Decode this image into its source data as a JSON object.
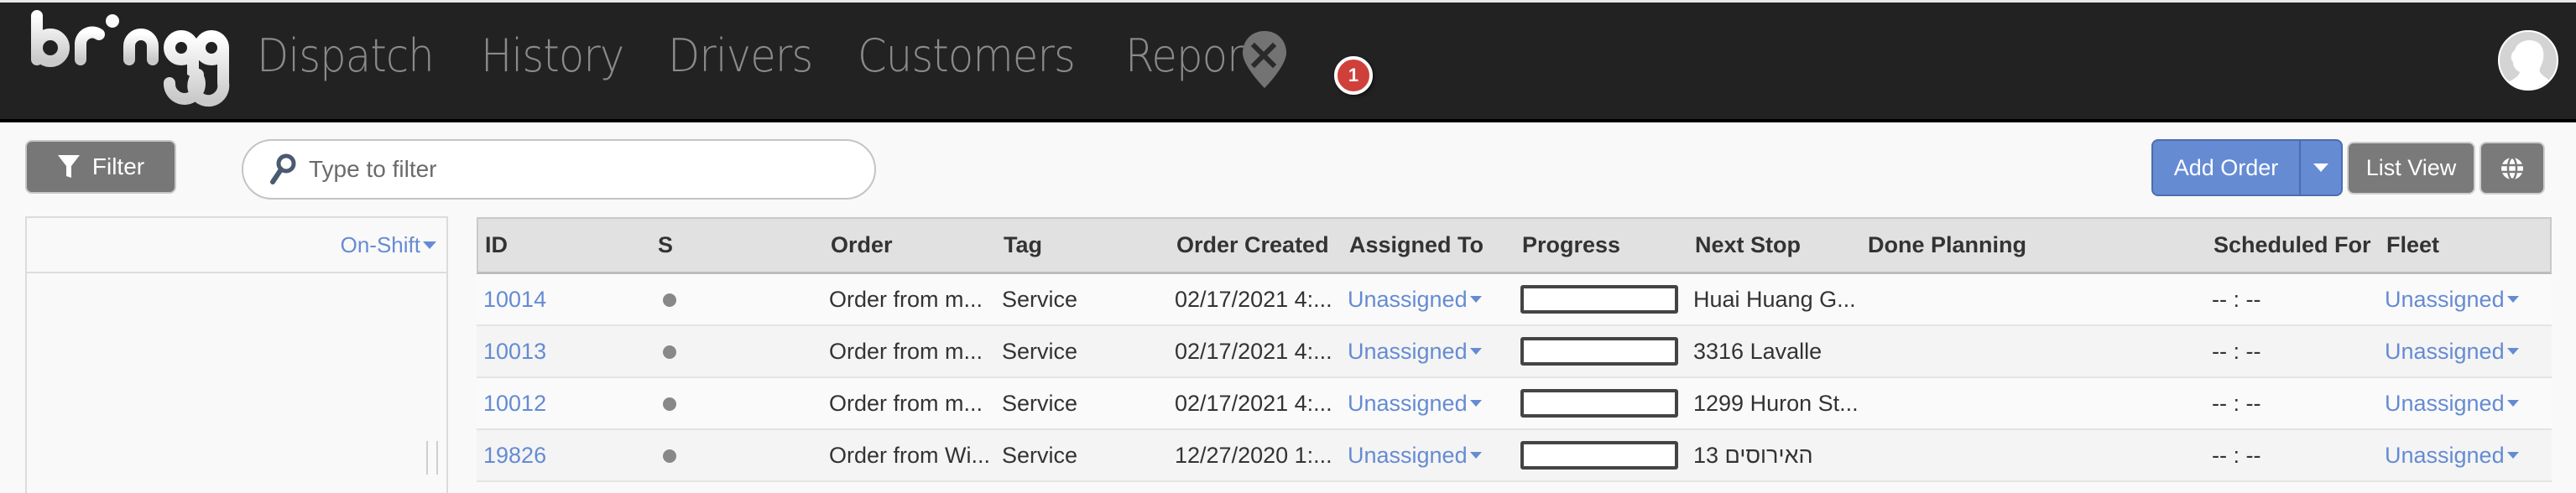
{
  "app": {
    "brand": "bringg",
    "nav": [
      {
        "label": "Dispatch"
      },
      {
        "label": "History"
      },
      {
        "label": "Drivers"
      },
      {
        "label": "Customers"
      },
      {
        "label": "Reports"
      }
    ],
    "notification_count": "1",
    "avatar_icon": "user-avatar-icon"
  },
  "toolbar": {
    "filter_label": "Filter",
    "search_placeholder": "Type to filter",
    "search_value": "",
    "add_order_label": "Add Order",
    "list_view_label": "List View",
    "globe_icon": "globe-icon"
  },
  "side_panel": {
    "on_shift_label": "On-Shift"
  },
  "table": {
    "columns": [
      "ID",
      "S",
      "Order",
      "Tag",
      "Order Created",
      "Assigned To",
      "Progress",
      "Next Stop",
      "Done Planning",
      "Scheduled For",
      "Fleet"
    ],
    "rows": [
      {
        "id": "10014",
        "status": "gray",
        "order": "Order from m...",
        "tag": "Service",
        "created": "02/17/2021 4:...",
        "assigned_to": "Unassigned",
        "progress": 0,
        "next_stop": "Huai Huang G...",
        "done_planning": "",
        "scheduled_for": "-- : --",
        "fleet": "Unassigned"
      },
      {
        "id": "10013",
        "status": "gray",
        "order": "Order from m...",
        "tag": "Service",
        "created": "02/17/2021 4:...",
        "assigned_to": "Unassigned",
        "progress": 0,
        "next_stop": "3316 Lavalle",
        "done_planning": "",
        "scheduled_for": "-- : --",
        "fleet": "Unassigned"
      },
      {
        "id": "10012",
        "status": "gray",
        "order": "Order from m...",
        "tag": "Service",
        "created": "02/17/2021 4:...",
        "assigned_to": "Unassigned",
        "progress": 0,
        "next_stop": "1299 Huron St...",
        "done_planning": "",
        "scheduled_for": "-- : --",
        "fleet": "Unassigned"
      },
      {
        "id": "19826",
        "status": "gray",
        "order": "Order from Wi...",
        "tag": "Service",
        "created": "12/27/2020 1:...",
        "assigned_to": "Unassigned",
        "progress": 0,
        "next_stop": "האירוסים 13",
        "done_planning": "",
        "scheduled_for": "-- : --",
        "fleet": "Unassigned"
      }
    ]
  },
  "colors": {
    "accent": "#658bd3",
    "header_bg": "#222222",
    "badge": "#d0403a",
    "status_dot": "#888888"
  }
}
